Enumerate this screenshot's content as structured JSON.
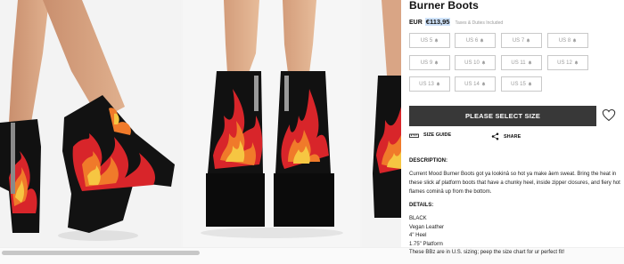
{
  "product": {
    "title": "Burner Boots",
    "currency": "EUR",
    "price": "€113,95",
    "tax_note": "Taxes & Duties Included"
  },
  "sizes": [
    {
      "label": "US 5",
      "available": false
    },
    {
      "label": "US 6",
      "available": false
    },
    {
      "label": "US 7",
      "available": false
    },
    {
      "label": "US 8",
      "available": false
    },
    {
      "label": "US 9",
      "available": false
    },
    {
      "label": "US 10",
      "available": false
    },
    {
      "label": "US 11",
      "available": false
    },
    {
      "label": "US 12",
      "available": false
    },
    {
      "label": "US 13",
      "available": false
    },
    {
      "label": "US 14",
      "available": false
    },
    {
      "label": "US 15",
      "available": false
    }
  ],
  "actions": {
    "select_size": "PLEASE SELECT SIZE",
    "size_guide": "SIZE GUIDE",
    "share": "SHARE"
  },
  "description": {
    "heading": "DESCRIPTION:",
    "text": "Current Mood Burner Boots got ya lookinâ so hot ya make âem sweat. Bring the heat in these slick af platform boots that have a chunky heel, inside zipper closures, and fiery hot flames cominâ up from the bottom."
  },
  "details": {
    "heading": "DETAILS:",
    "lines": [
      "BLACK",
      "Vegan Leather",
      "4\" Heel",
      "1.75\" Platform",
      "These BBz are in U.S. sizing; peep the size chart for ur perfect fit!"
    ]
  },
  "icons": {
    "size_unavailable": "bell-icon",
    "wishlist": "heart-icon",
    "size_guide": "ruler-icon",
    "share": "share-icon"
  },
  "colors": {
    "button_bg": "#383838",
    "price_highlight": "#cfe3fb",
    "flame_red": "#d8252a",
    "flame_orange": "#f07a2a",
    "flame_yellow": "#f6c642"
  }
}
